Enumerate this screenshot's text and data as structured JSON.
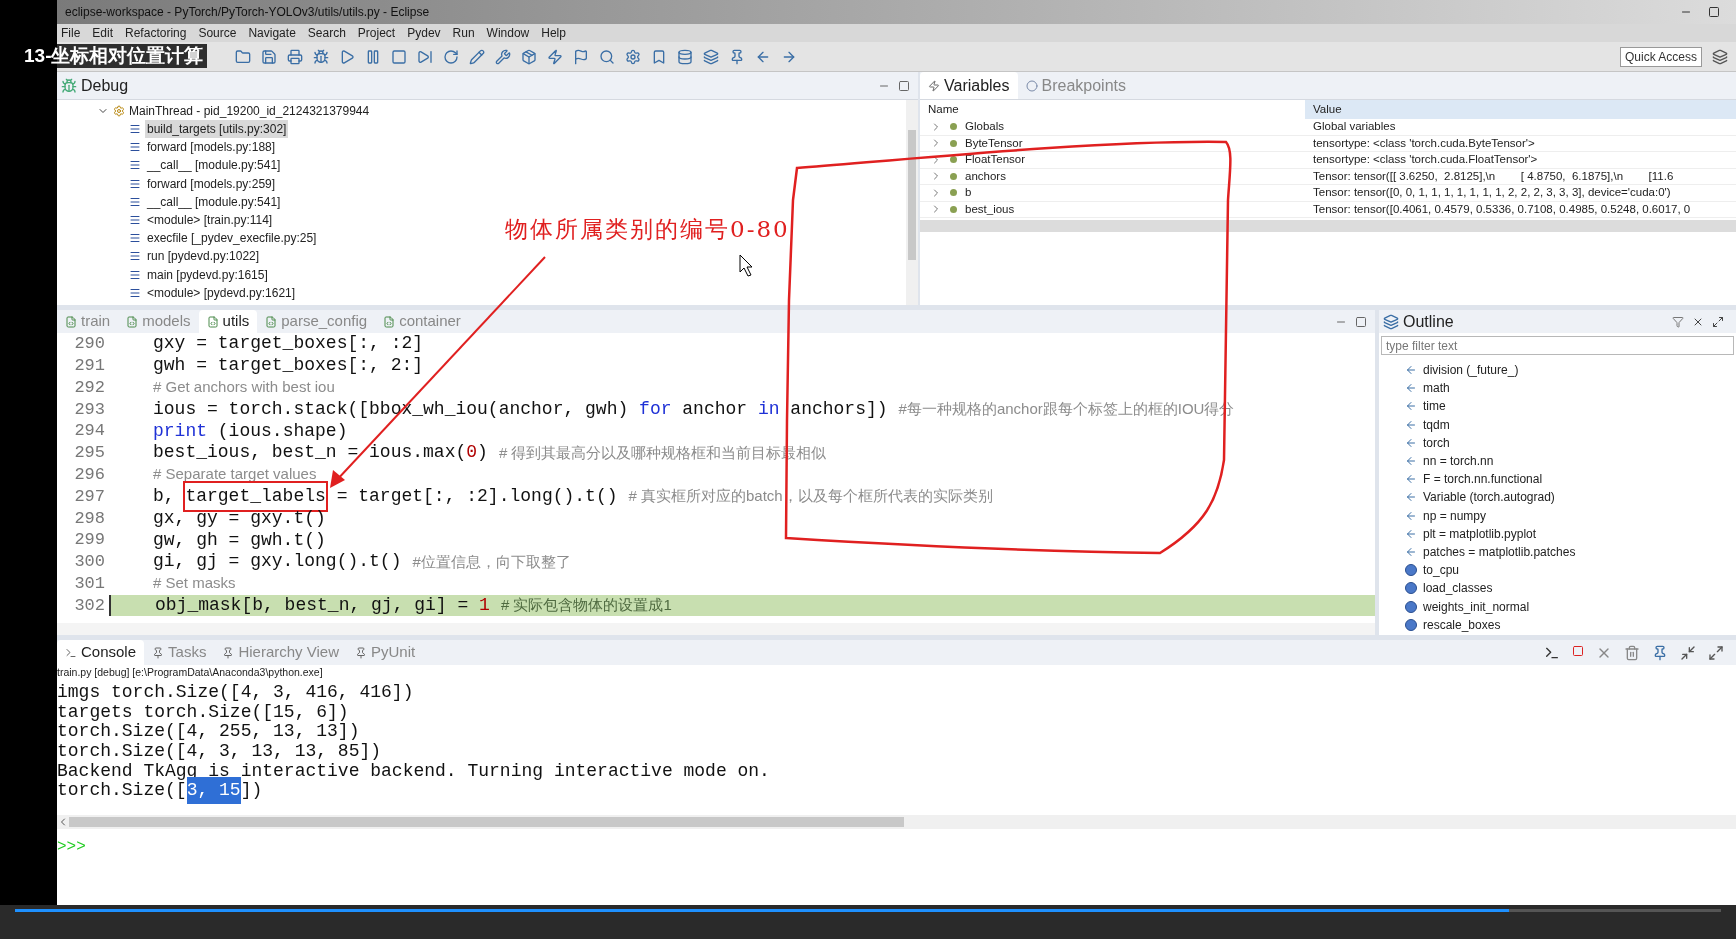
{
  "overlay_title": "13-坐标相对位置计算",
  "window": {
    "title": "eclipse-workspace - PyTorch/PyTorch-YOLOv3/utils/utils.py - Eclipse"
  },
  "menu": [
    "File",
    "Edit",
    "Refactoring",
    "Source",
    "Navigate",
    "Search",
    "Project",
    "Pydev",
    "Run",
    "Window",
    "Help"
  ],
  "quick_access": "Quick Access",
  "debug": {
    "tab": "Debug",
    "thread": {
      "label": "MainThread - pid_19200_id_2124321379944",
      "expanded": true
    },
    "frames": [
      {
        "label": "build_targets [utils.py:302]",
        "selected": true
      },
      {
        "label": "forward [models.py:188]",
        "selected": false
      },
      {
        "label": "__call__ [module.py:541]",
        "selected": false
      },
      {
        "label": "forward [models.py:259]",
        "selected": false
      },
      {
        "label": "__call__ [module.py:541]",
        "selected": false
      },
      {
        "label": "<module> [train.py:114]",
        "selected": false
      },
      {
        "label": "execfile [_pydev_execfile.py:25]",
        "selected": false
      },
      {
        "label": "run [pydevd.py:1022]",
        "selected": false
      },
      {
        "label": "main [pydevd.py:1615]",
        "selected": false
      },
      {
        "label": "<module> [pydevd.py:1621]",
        "selected": false
      }
    ]
  },
  "variables": {
    "tabs": [
      {
        "label": "Variables",
        "selected": true
      },
      {
        "label": "Breakpoints",
        "selected": false
      }
    ],
    "columns": [
      "Name",
      "Value"
    ],
    "rows": [
      {
        "name": "Globals",
        "value": "Global variables"
      },
      {
        "name": "ByteTensor",
        "value": "tensortype: <class 'torch.cuda.ByteTensor'>"
      },
      {
        "name": "FloatTensor",
        "value": "tensortype: <class 'torch.cuda.FloatTensor'>"
      },
      {
        "name": "anchors",
        "value": "Tensor: tensor([[ 3.6250,  2.8125],\\n        [ 4.8750,  6.1875],\\n        [11.6"
      },
      {
        "name": "b",
        "value": "Tensor: tensor([0, 0, 1, 1, 1, 1, 1, 1, 1, 2, 2, 2, 3, 3, 3], device='cuda:0')"
      },
      {
        "name": "best_ious",
        "value": "Tensor: tensor([0.4061, 0.4579, 0.5336, 0.7108, 0.4985, 0.5248, 0.6017, 0"
      }
    ]
  },
  "editor": {
    "tabs": [
      {
        "label": "train",
        "selected": false
      },
      {
        "label": "models",
        "selected": false
      },
      {
        "label": "utils",
        "selected": true
      },
      {
        "label": "parse_config",
        "selected": false
      },
      {
        "label": "container",
        "selected": false
      }
    ],
    "lines": [
      {
        "number": "290",
        "current": false,
        "segments": [
          {
            "kind": "code",
            "text": "gxy = target_boxes[:, :2]"
          }
        ]
      },
      {
        "number": "291",
        "current": false,
        "segments": [
          {
            "kind": "code",
            "text": "gwh = target_boxes[:, 2:]"
          }
        ]
      },
      {
        "number": "292",
        "current": false,
        "segments": [
          {
            "kind": "comment",
            "text": "# Get anchors with best iou"
          }
        ]
      },
      {
        "number": "293",
        "current": false,
        "segments": [
          {
            "kind": "code",
            "text": "ious = torch.stack([bbox_wh_iou(anchor, gwh) "
          },
          {
            "kind": "keyword",
            "text": "for"
          },
          {
            "kind": "code",
            "text": " anchor "
          },
          {
            "kind": "keyword",
            "text": "in"
          },
          {
            "kind": "code",
            "text": " anchors])"
          },
          {
            "kind": "comment",
            "text": "#每一种规格的anchor跟每个标签上的框的IOU得分"
          }
        ]
      },
      {
        "number": "294",
        "current": false,
        "segments": [
          {
            "kind": "keyword",
            "text": "print"
          },
          {
            "kind": "code",
            "text": " (ious.shape)"
          }
        ]
      },
      {
        "number": "295",
        "current": false,
        "segments": [
          {
            "kind": "code",
            "text": "best_ious, best_n = ious.max("
          },
          {
            "kind": "number",
            "text": "0"
          },
          {
            "kind": "code",
            "text": ")"
          },
          {
            "kind": "comment",
            "text": "# 得到其最高分以及哪种规格框和当前目标最相似"
          }
        ]
      },
      {
        "number": "296",
        "current": false,
        "segments": [
          {
            "kind": "comment",
            "text": "# Separate target values"
          }
        ]
      },
      {
        "number": "297",
        "current": false,
        "segments": [
          {
            "kind": "code",
            "text": "b, "
          },
          {
            "kind": "boxed",
            "text": "target_labels"
          },
          {
            "kind": "code",
            "text": " = target[:, :2].long().t()"
          },
          {
            "kind": "comment",
            "text": "# 真实框所对应的batch，以及每个框所代表的实际类别"
          }
        ]
      },
      {
        "number": "298",
        "current": false,
        "segments": [
          {
            "kind": "code",
            "text": "gx, gy = gxy.t()"
          }
        ]
      },
      {
        "number": "299",
        "current": false,
        "segments": [
          {
            "kind": "code",
            "text": "gw, gh = gwh.t()"
          }
        ]
      },
      {
        "number": "300",
        "current": false,
        "segments": [
          {
            "kind": "code",
            "text": "gi, gj = gxy.long().t()"
          },
          {
            "kind": "comment",
            "text": "#位置信息，向下取整了"
          }
        ]
      },
      {
        "number": "301",
        "current": false,
        "segments": [
          {
            "kind": "comment",
            "text": "# Set masks"
          }
        ]
      },
      {
        "number": "302",
        "current": true,
        "segments": [
          {
            "kind": "code",
            "text": "obj_mask[b, best_n, gj, gi] = "
          },
          {
            "kind": "number",
            "text": "1"
          },
          {
            "kind": "comment",
            "text": "# 实际包含物体的设置成1"
          }
        ]
      }
    ]
  },
  "outline": {
    "tab": "Outline",
    "filter": {
      "placeholder": "type filter text"
    },
    "items": [
      {
        "kind": "import",
        "label": "division (_future_)"
      },
      {
        "kind": "import",
        "label": "math"
      },
      {
        "kind": "import",
        "label": "time"
      },
      {
        "kind": "import",
        "label": "tqdm"
      },
      {
        "kind": "import",
        "label": "torch"
      },
      {
        "kind": "import",
        "label": "nn = torch.nn"
      },
      {
        "kind": "import",
        "label": "F = torch.nn.functional"
      },
      {
        "kind": "import",
        "label": "Variable (torch.autograd)"
      },
      {
        "kind": "import",
        "label": "np = numpy"
      },
      {
        "kind": "import",
        "label": "plt = matplotlib.pyplot"
      },
      {
        "kind": "import",
        "label": "patches = matplotlib.patches"
      },
      {
        "kind": "function",
        "label": "to_cpu"
      },
      {
        "kind": "function",
        "label": "load_classes"
      },
      {
        "kind": "function",
        "label": "weights_init_normal"
      },
      {
        "kind": "function",
        "label": "rescale_boxes"
      }
    ]
  },
  "console": {
    "tabs": [
      {
        "label": "Console",
        "selected": true
      },
      {
        "label": "Tasks",
        "selected": false
      },
      {
        "label": "Hierarchy View",
        "selected": false
      },
      {
        "label": "PyUnit",
        "selected": false
      }
    ],
    "process": "train.py [debug] [e:\\ProgramData\\Anaconda3\\python.exe]",
    "lines": [
      [
        {
          "text": "imgs torch.Size([4, 3, 416, 416])",
          "selected": false
        }
      ],
      [
        {
          "text": "targets torch.Size([15, 6])",
          "selected": false
        }
      ],
      [
        {
          "text": "torch.Size([4, 255, 13, 13])",
          "selected": false
        }
      ],
      [
        {
          "text": "torch.Size([4, 3, 13, 13, 85])",
          "selected": false
        }
      ],
      [
        {
          "text": "Backend TkAgg is interactive backend. Turning interactive mode on.",
          "selected": false
        }
      ],
      [
        {
          "text": "torch.Size([",
          "selected": false
        },
        {
          "text": "3, 15",
          "selected": true
        },
        {
          "text": "])",
          "selected": false
        }
      ]
    ],
    "prompt": ">>>"
  },
  "annotation": {
    "text": "物体所属类别的编号0-80"
  },
  "video_progress": {
    "level": 0.876
  }
}
